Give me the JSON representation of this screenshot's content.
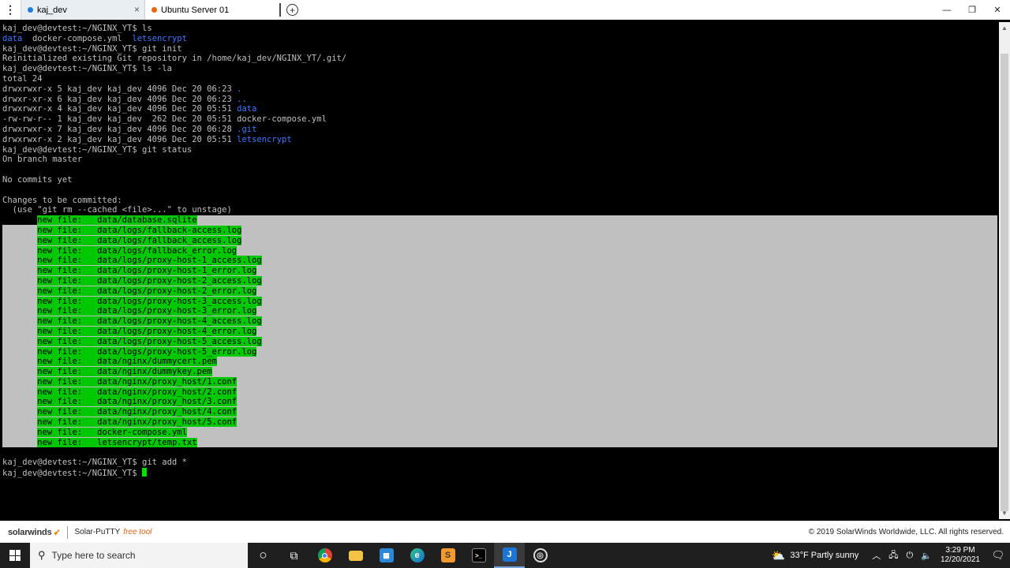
{
  "titlebar": {
    "tabs": [
      {
        "label": "kaj_dev",
        "color": "#1e7fd6",
        "active": true,
        "close": "×"
      },
      {
        "label": "Ubuntu Server 01",
        "color": "#e8650a",
        "active": false
      }
    ],
    "add_tab": "+",
    "window_controls": [
      "—",
      "❐",
      "✕"
    ]
  },
  "terminal": {
    "prompt": "kaj_dev@devtest:~/NGINX_YT$",
    "lines_before": [
      {
        "text": "kaj_dev@devtest:~/NGINX_YT$ ls"
      },
      {
        "parts": [
          {
            "t": "data",
            "c": "blue"
          },
          {
            "t": "  docker-compose.yml  ",
            "c": ""
          },
          {
            "t": "letsencrypt",
            "c": "blue"
          }
        ]
      },
      {
        "text": "kaj_dev@devtest:~/NGINX_YT$ git init"
      },
      {
        "text": "Reinitialized existing Git repository in /home/kaj_dev/NGINX_YT/.git/"
      },
      {
        "text": "kaj_dev@devtest:~/NGINX_YT$ ls -la"
      },
      {
        "text": "total 24"
      },
      {
        "parts": [
          {
            "t": "drwxrwxr-x 5 kaj_dev kaj_dev 4096 Dec 20 06:23 ",
            "c": ""
          },
          {
            "t": ".",
            "c": "blue"
          }
        ]
      },
      {
        "parts": [
          {
            "t": "drwxr-xr-x 6 kaj_dev kaj_dev 4096 Dec 20 06:23 ",
            "c": ""
          },
          {
            "t": "..",
            "c": "blue"
          }
        ]
      },
      {
        "parts": [
          {
            "t": "drwxrwxr-x 4 kaj_dev kaj_dev 4096 Dec 20 05:51 ",
            "c": ""
          },
          {
            "t": "data",
            "c": "blue"
          }
        ]
      },
      {
        "text": "-rw-rw-r-- 1 kaj_dev kaj_dev  262 Dec 20 05:51 docker-compose.yml"
      },
      {
        "parts": [
          {
            "t": "drwxrwxr-x 7 kaj_dev kaj_dev 4096 Dec 20 06:28 ",
            "c": ""
          },
          {
            "t": ".git",
            "c": "blue"
          }
        ]
      },
      {
        "parts": [
          {
            "t": "drwxrwxr-x 2 kaj_dev kaj_dev 4096 Dec 20 05:51 ",
            "c": ""
          },
          {
            "t": "letsencrypt",
            "c": "blue"
          }
        ]
      },
      {
        "text": "kaj_dev@devtest:~/NGINX_YT$ git status"
      },
      {
        "text": "On branch master"
      },
      {
        "text": ""
      },
      {
        "text": "No commits yet"
      },
      {
        "text": ""
      },
      {
        "text": "Changes to be committed:"
      },
      {
        "text": "  (use \"git rm --cached <file>...\" to unstage)"
      }
    ],
    "new_file_label": "new file:",
    "staged_files": [
      "data/database.sqlite",
      "data/logs/fallback-access.log",
      "data/logs/fallback_access.log",
      "data/logs/fallback_error.log",
      "data/logs/proxy-host-1_access.log",
      "data/logs/proxy-host-1_error.log",
      "data/logs/proxy-host-2_access.log",
      "data/logs/proxy-host-2_error.log",
      "data/logs/proxy-host-3_access.log",
      "data/logs/proxy-host-3_error.log",
      "data/logs/proxy-host-4_access.log",
      "data/logs/proxy-host-4_error.log",
      "data/logs/proxy-host-5_access.log",
      "data/logs/proxy-host-5_error.log",
      "data/nginx/dummycert.pem",
      "data/nginx/dummykey.pem",
      "data/nginx/proxy_host/1.conf",
      "data/nginx/proxy_host/2.conf",
      "data/nginx/proxy_host/3.conf",
      "data/nginx/proxy_host/4.conf",
      "data/nginx/proxy_host/5.conf",
      "docker-compose.yml",
      "letsencrypt/temp.txt"
    ],
    "lines_after": [
      {
        "text": ""
      },
      {
        "text": "kaj_dev@devtest:~/NGINX_YT$ git add *"
      },
      {
        "text": "kaj_dev@devtest:~/NGINX_YT$ "
      }
    ]
  },
  "footer": {
    "brand": "solarwinds",
    "product": "Solar-PuTTY",
    "free_tool": "free tool",
    "copyright": "© 2019 SolarWinds Worldwide, LLC. All rights reserved."
  },
  "taskbar": {
    "search_placeholder": "Type here to search",
    "weather": "33°F  Partly sunny",
    "time": "3:29 PM",
    "date": "12/20/2021",
    "apps": [
      {
        "name": "cortana-icon",
        "glyph": "○"
      },
      {
        "name": "task-view-icon",
        "glyph": "⧉"
      },
      {
        "name": "chrome-icon",
        "glyph": "●"
      },
      {
        "name": "file-explorer-icon",
        "glyph": "▬"
      },
      {
        "name": "store-icon",
        "glyph": "▦"
      },
      {
        "name": "edge-icon",
        "glyph": "e"
      },
      {
        "name": "sublime-icon",
        "glyph": "S"
      },
      {
        "name": "terminal-icon",
        "glyph": ">_"
      },
      {
        "name": "solar-putty-icon",
        "glyph": "J"
      },
      {
        "name": "obs-icon",
        "glyph": "◎"
      }
    ]
  }
}
